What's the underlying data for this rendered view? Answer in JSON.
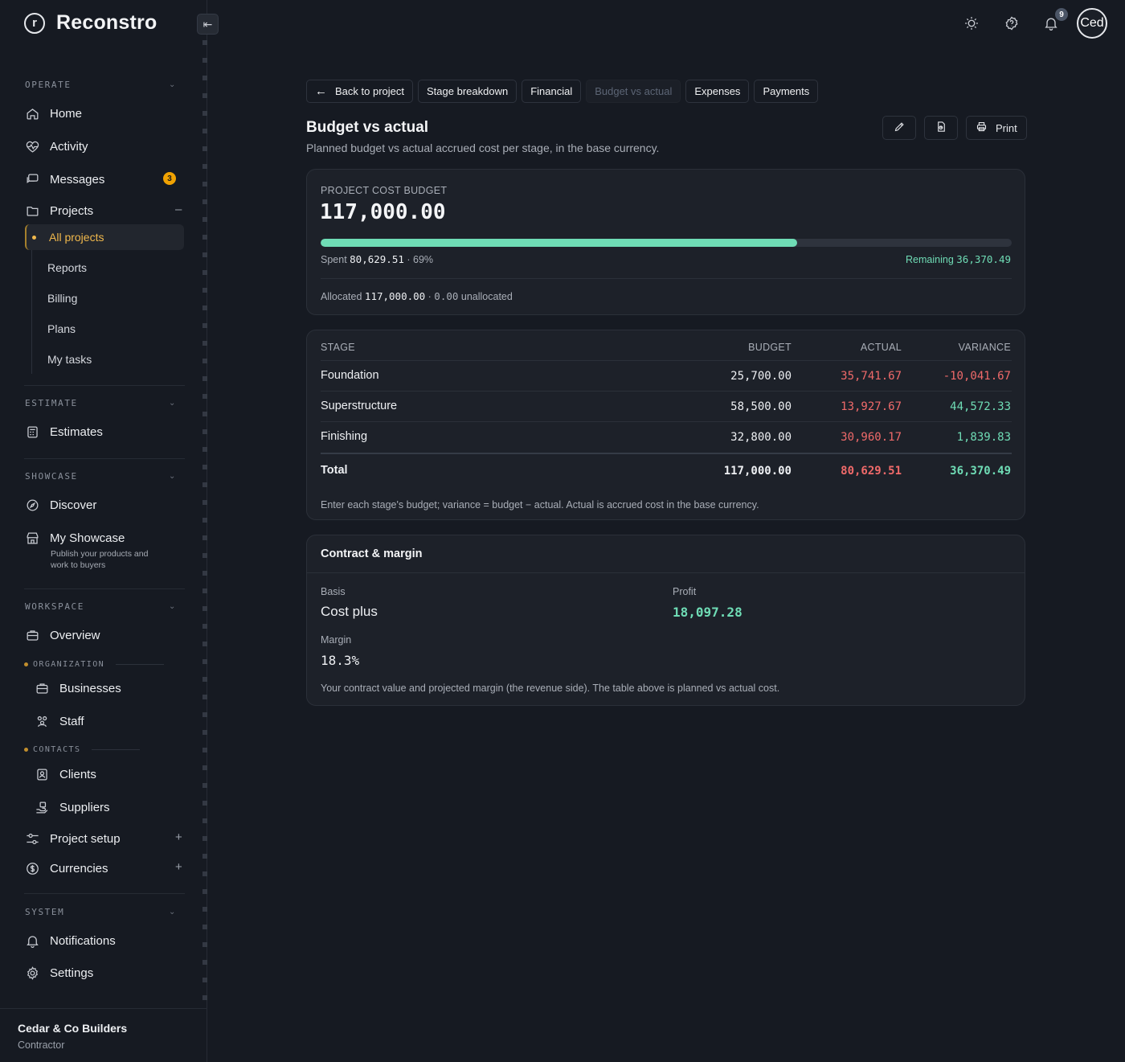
{
  "brand": {
    "logo_letter": "r",
    "name": "Reconstro"
  },
  "sidebar": {
    "sections": {
      "operate": "OPERATE",
      "estimate": "ESTIMATE",
      "showcase": "SHOWCASE",
      "workspace": "WORKSPACE",
      "system": "SYSTEM"
    },
    "items": {
      "home": "Home",
      "activity": "Activity",
      "messages": "Messages",
      "messages_badge": "3",
      "projects": "Projects",
      "all_projects": "All projects",
      "reports": "Reports",
      "billing": "Billing",
      "plans": "Plans",
      "my_tasks": "My tasks",
      "estimates": "Estimates",
      "discover": "Discover",
      "my_showcase": "My Showcase",
      "my_showcase_desc": "Publish your products and work to buyers",
      "overview": "Overview",
      "organization": "ORGANIZATION",
      "businesses": "Businesses",
      "staff": "Staff",
      "contacts": "CONTACTS",
      "clients": "Clients",
      "suppliers": "Suppliers",
      "project_setup": "Project setup",
      "currencies": "Currencies",
      "notifications": "Notifications",
      "settings": "Settings"
    },
    "footer": {
      "company": "Cedar & Co Builders",
      "role": "Contractor"
    }
  },
  "topbar": {
    "notification_count": "9",
    "avatar_text": "Ced"
  },
  "tabs": {
    "back": "Back to project",
    "stage_breakdown": "Stage breakdown",
    "financial": "Financial",
    "budget_vs_actual": "Budget vs actual",
    "expenses": "Expenses",
    "payments": "Payments"
  },
  "page": {
    "title": "Budget vs actual",
    "subtitle": "Planned budget vs actual accrued cost per stage, in the base currency.",
    "print_label": "Print"
  },
  "budget": {
    "label": "PROJECT COST BUDGET",
    "amount": "117,000.00",
    "spent_label": "Spent",
    "spent_value": "80,629.51",
    "spent_pct": "· 69%",
    "progress_fraction": 0.69,
    "remaining_label": "Remaining",
    "remaining_value": "36,370.49",
    "allocated_label": "Allocated",
    "allocated_value": "117,000.00",
    "unallocated_value": "0.00",
    "unallocated_label": "unallocated"
  },
  "table": {
    "headers": {
      "stage": "STAGE",
      "budget": "BUDGET",
      "actual": "ACTUAL",
      "variance": "VARIANCE"
    },
    "rows": [
      {
        "stage": "Foundation",
        "budget": "25,700.00",
        "actual": "35,741.67",
        "variance": "-10,041.67"
      },
      {
        "stage": "Superstructure",
        "budget": "58,500.00",
        "actual": "13,927.67",
        "variance": "44,572.33"
      },
      {
        "stage": "Finishing",
        "budget": "32,800.00",
        "actual": "30,960.17",
        "variance": "1,839.83"
      }
    ],
    "total": {
      "label": "Total",
      "budget": "117,000.00",
      "actual": "80,629.51",
      "variance": "36,370.49"
    },
    "note": "Enter each stage's budget; variance = budget − actual. Actual is accrued cost in the base currency."
  },
  "contract": {
    "title": "Contract & margin",
    "basis_label": "Basis",
    "basis_value": "Cost plus",
    "profit_label": "Profit",
    "profit_value": "18,097.28",
    "margin_label": "Margin",
    "margin_value": "18.3%",
    "note": "Your contract value and projected margin (the revenue side). The table above is planned vs actual cost."
  }
}
